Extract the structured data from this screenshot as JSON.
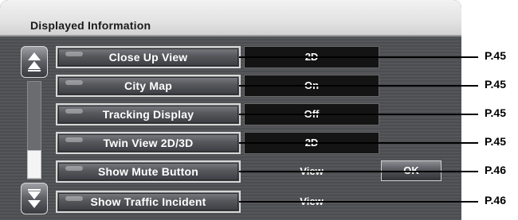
{
  "header": {
    "title": "Displayed Information"
  },
  "rows": [
    {
      "label": "Close Up View",
      "value": "2D",
      "page_ref": "P.45"
    },
    {
      "label": "City Map",
      "value": "On",
      "page_ref": "P.45"
    },
    {
      "label": "Tracking Display",
      "value": "Off",
      "page_ref": "P.45"
    },
    {
      "label": "Twin View 2D/3D",
      "value": "2D",
      "page_ref": "P.45"
    },
    {
      "label": "Show Mute Button",
      "value": "View",
      "page_ref": "P.46"
    },
    {
      "label": "Show Traffic Incident",
      "value": "View",
      "page_ref": "P.46"
    }
  ],
  "ok_button": {
    "label": "OK"
  },
  "icons": {
    "scroll_up": "double-up-arrow-icon",
    "scroll_down": "double-down-arrow-icon"
  },
  "colors": {
    "panel_background": "#55565a",
    "header_background": "#e2e2e2",
    "value_box": "#141414",
    "leader_line": "#000000"
  }
}
